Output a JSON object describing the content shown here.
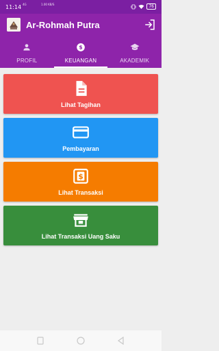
{
  "status_bar": {
    "time": "11:14",
    "network": "4G",
    "speed": "1.00 KB/S",
    "battery": "76"
  },
  "app_bar": {
    "title": "Ar-Rohmah Putra",
    "logo_icon": "school-logo",
    "action_icon": "logout-icon"
  },
  "tabs": [
    {
      "label": "PROFIL",
      "icon": "person-icon",
      "active": false
    },
    {
      "label": "KEUANGAN",
      "icon": "dollar-icon",
      "active": true
    },
    {
      "label": "AKADEMIK",
      "icon": "school-icon",
      "active": false
    }
  ],
  "menu": [
    {
      "label": "Lihat Tagihan",
      "icon": "document-icon",
      "color": "#ef5350"
    },
    {
      "label": "Pembayaran",
      "icon": "credit-card-icon",
      "color": "#2196f3"
    },
    {
      "label": "Lihat Transaksi",
      "icon": "receipt-dollar-icon",
      "color": "#f57c00"
    },
    {
      "label": "Lihat Transaksi Uang Saku",
      "icon": "store-icon",
      "color": "#388e3c"
    }
  ],
  "colors": {
    "primary": "#8e24aa",
    "status_bar": "#7b1fa2",
    "background": "#eeeeee"
  }
}
